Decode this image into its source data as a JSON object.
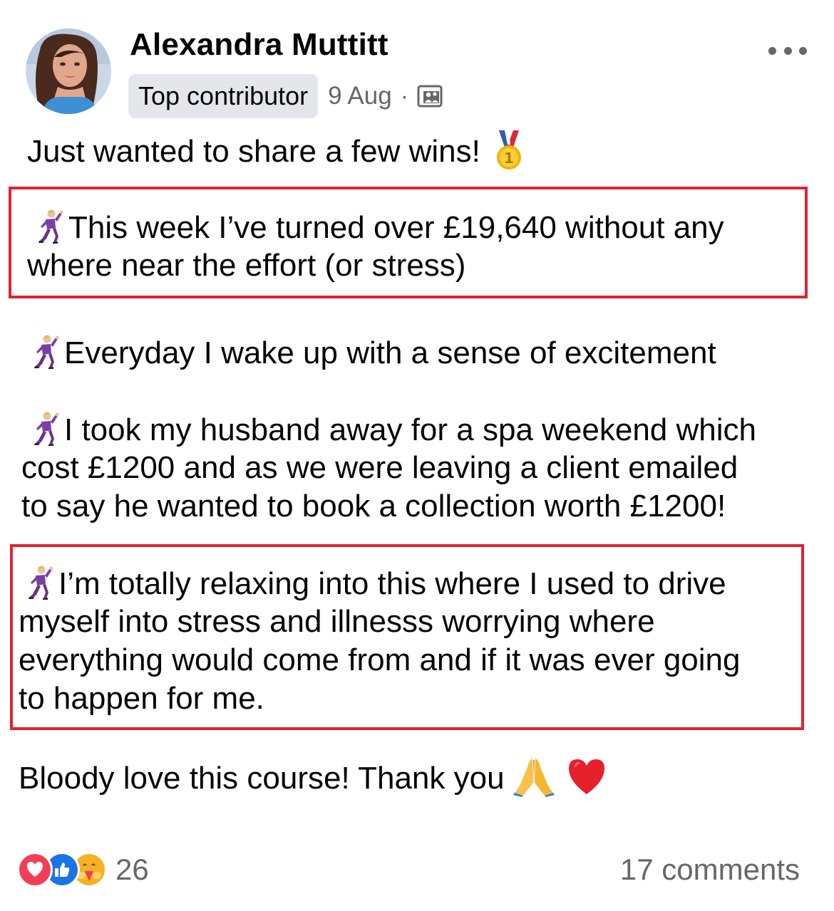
{
  "post": {
    "author": "Alexandra Muttitt",
    "badge": "Top contributor",
    "timestamp": "9 Aug",
    "separator": "·",
    "audience_icon": "group-photo-icon",
    "menu_icon": "more-options-icon"
  },
  "body": {
    "intro": "Just wanted to share a few wins!",
    "win1_line1": "This week I’ve turned over £19,640 without any",
    "win1_line2": "where near the effort (or stress)",
    "win2_line1": "Everyday I wake up with a sense of excitement",
    "win3_line1": "I took my husband away for a spa weekend which",
    "win3_line2": "cost £1200 and as we were leaving a client emailed",
    "win3_line3": "to say he wanted to book a  collection worth £1200!",
    "win4_line1": "I’m totally relaxing into this where I used to drive",
    "win4_line2": "myself into stress and illnesss worrying where",
    "win4_line3": "everything would come from and if it was ever going",
    "win4_line4": "to happen for me.",
    "closing": "Bloody love this course! Thank you",
    "emoji": {
      "bullet": "man-dancing-emoji",
      "medal": "first-place-medal-emoji",
      "pray": "folded-hands-emoji",
      "heart": "red-heart-emoji"
    }
  },
  "footer": {
    "reaction_count": "26",
    "reactions": [
      "love",
      "like",
      "care"
    ],
    "comments": "17 comments"
  },
  "colors": {
    "highlight": "#e0242e",
    "secondary_text": "#65676b",
    "badge_bg": "#e4e6eb",
    "like_blue": "#1b74e4",
    "love_red": "#f33e58",
    "care_yellow": "#f7b125"
  }
}
